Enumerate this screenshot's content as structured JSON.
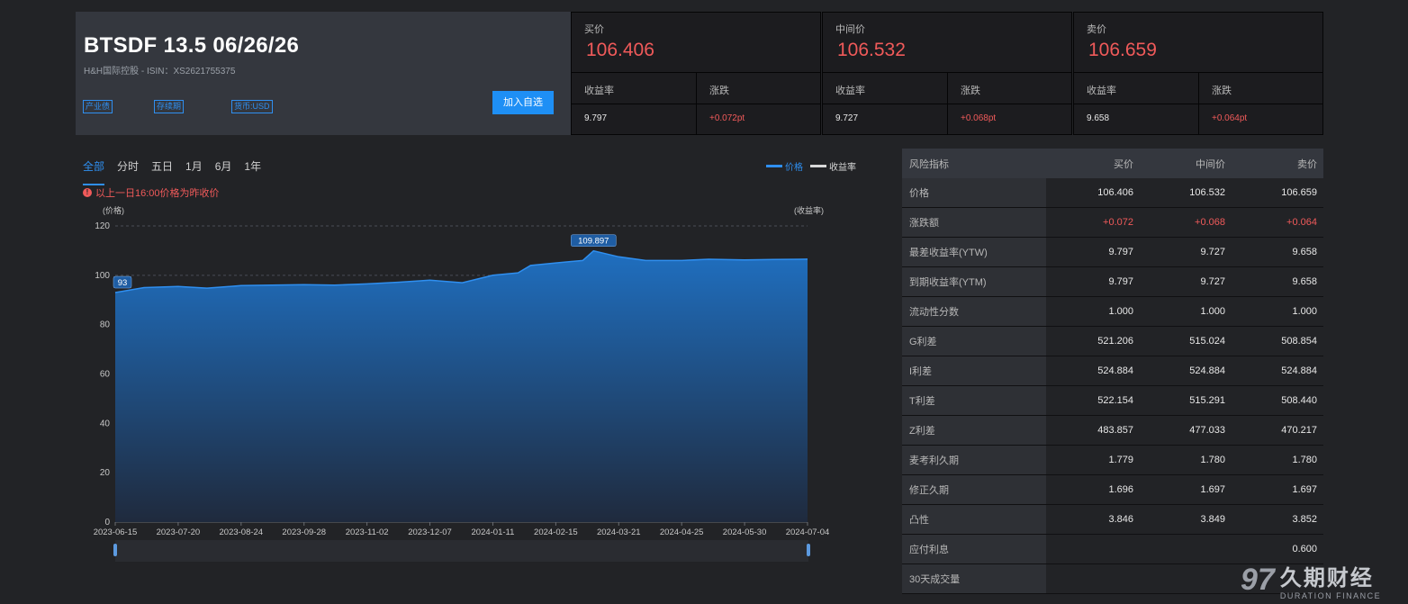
{
  "header": {
    "title": "BTSDF 13.5 06/26/26",
    "subtitle": "H&H国际控股 - ISIN：XS2621755375",
    "tags": [
      "产业债",
      "存续期",
      "货币:USD"
    ],
    "add_button": "加入自选"
  },
  "quotes": [
    {
      "label": "买价",
      "price": "106.406",
      "yield_label": "收益率",
      "change_label": "涨跌",
      "yield": "9.797",
      "change": "+0.072pt"
    },
    {
      "label": "中间价",
      "price": "106.532",
      "yield_label": "收益率",
      "change_label": "涨跌",
      "yield": "9.727",
      "change": "+0.068pt"
    },
    {
      "label": "卖价",
      "price": "106.659",
      "yield_label": "收益率",
      "change_label": "涨跌",
      "yield": "9.658",
      "change": "+0.064pt"
    }
  ],
  "chart": {
    "tabs": [
      "全部",
      "分时",
      "五日",
      "1月",
      "6月",
      "1年"
    ],
    "active_tab": "全部",
    "legend": [
      {
        "name": "价格",
        "color": "#2f8ff0"
      },
      {
        "name": "收益率",
        "color": "#d8d8d8"
      }
    ],
    "notice": "以上一日16:00价格为昨收价",
    "left_axis_title": "(价格)",
    "right_axis_title": "(收益率)"
  },
  "chart_data": {
    "type": "area",
    "x": [
      "2023-06-15",
      "2023-07-01",
      "2023-07-20",
      "2023-08-05",
      "2023-08-24",
      "2023-09-10",
      "2023-09-28",
      "2023-10-15",
      "2023-11-02",
      "2023-11-20",
      "2023-12-07",
      "2023-12-25",
      "2024-01-11",
      "2024-01-25",
      "2024-02-01",
      "2024-02-15",
      "2024-03-01",
      "2024-03-07",
      "2024-03-21",
      "2024-04-05",
      "2024-04-25",
      "2024-05-10",
      "2024-05-30",
      "2024-06-15",
      "2024-07-04"
    ],
    "series": [
      {
        "name": "价格",
        "values": [
          93,
          95,
          95.5,
          94.8,
          95.8,
          96,
          96.2,
          96,
          96.5,
          97.2,
          98,
          97,
          100,
          101,
          104,
          105,
          106,
          109.897,
          107.5,
          106,
          106,
          106.5,
          106.2,
          106.4,
          106.532
        ]
      }
    ],
    "ylim": [
      0,
      120
    ],
    "yticks": [
      0,
      20,
      40,
      60,
      80,
      100,
      120
    ],
    "xticks": [
      "2023-06-15",
      "2023-07-20",
      "2023-08-24",
      "2023-09-28",
      "2023-11-02",
      "2023-12-07",
      "2024-01-11",
      "2024-02-15",
      "2024-03-21",
      "2024-04-25",
      "2024-05-30",
      "2024-07-04"
    ],
    "annotations": [
      {
        "x": "2023-06-15",
        "label": "93"
      },
      {
        "x": "2024-03-07",
        "label": "109.897"
      }
    ],
    "grid": true
  },
  "risk_table": {
    "headers": [
      "风险指标",
      "买价",
      "中间价",
      "卖价"
    ],
    "rows": [
      {
        "label": "价格",
        "bid": "106.406",
        "mid": "106.532",
        "ask": "106.659",
        "red": false
      },
      {
        "label": "涨跌额",
        "bid": "+0.072",
        "mid": "+0.068",
        "ask": "+0.064",
        "red": true
      },
      {
        "label": "最差收益率(YTW)",
        "bid": "9.797",
        "mid": "9.727",
        "ask": "9.658",
        "red": false
      },
      {
        "label": "到期收益率(YTM)",
        "bid": "9.797",
        "mid": "9.727",
        "ask": "9.658",
        "red": false
      },
      {
        "label": "流动性分数",
        "bid": "1.000",
        "mid": "1.000",
        "ask": "1.000",
        "red": false
      },
      {
        "label": "G利差",
        "bid": "521.206",
        "mid": "515.024",
        "ask": "508.854",
        "red": false
      },
      {
        "label": "I利差",
        "bid": "524.884",
        "mid": "524.884",
        "ask": "524.884",
        "red": false
      },
      {
        "label": "T利差",
        "bid": "522.154",
        "mid": "515.291",
        "ask": "508.440",
        "red": false
      },
      {
        "label": "Z利差",
        "bid": "483.857",
        "mid": "477.033",
        "ask": "470.217",
        "red": false
      },
      {
        "label": "麦考利久期",
        "bid": "1.779",
        "mid": "1.780",
        "ask": "1.780",
        "red": false
      },
      {
        "label": "修正久期",
        "bid": "1.696",
        "mid": "1.697",
        "ask": "1.697",
        "red": false
      },
      {
        "label": "凸性",
        "bid": "3.846",
        "mid": "3.849",
        "ask": "3.852",
        "red": false
      },
      {
        "label": "应付利息",
        "bid": "",
        "mid": "",
        "ask": "0.600",
        "red": false
      },
      {
        "label": "30天成交量",
        "bid": "",
        "mid": "",
        "ask": "",
        "red": false
      }
    ]
  },
  "watermark": {
    "logo": "97",
    "name_cn": "久期财经",
    "name_en": "DURATION FINANCE"
  }
}
